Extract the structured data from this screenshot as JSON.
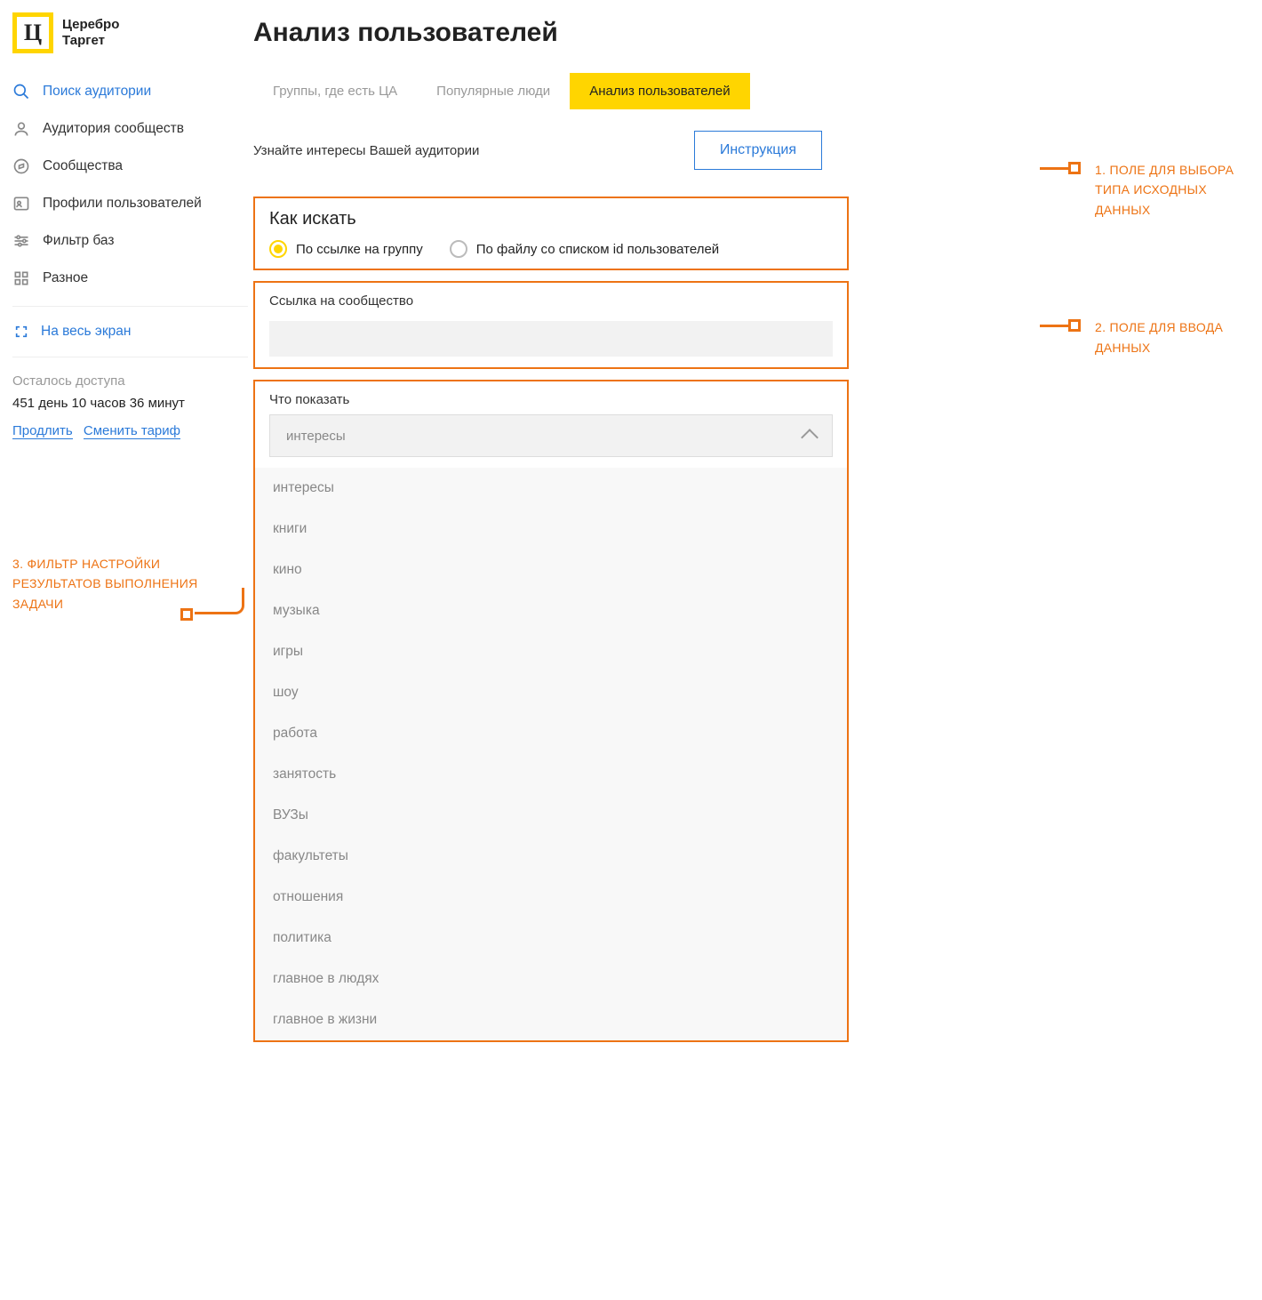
{
  "brand": {
    "line1": "Церебро",
    "line2": "Таргет",
    "letter": "Ц"
  },
  "sidebar": {
    "items": [
      {
        "label": "Поиск аудитории"
      },
      {
        "label": "Аудитория сообществ"
      },
      {
        "label": "Сообщества"
      },
      {
        "label": "Профили пользователей"
      },
      {
        "label": "Фильтр баз"
      },
      {
        "label": "Разное"
      }
    ],
    "fullscreen": "На весь экран",
    "access_label": "Осталось доступа",
    "access_time": "451 день 10 часов 36 минут",
    "extend": "Продлить",
    "change_tariff": "Сменить тариф"
  },
  "page": {
    "title": "Анализ пользователей",
    "tabs": [
      {
        "label": "Группы, где есть ЦА"
      },
      {
        "label": "Популярные люди"
      },
      {
        "label": "Анализ пользователей"
      }
    ],
    "subhead": "Узнайте интересы Вашей аудитории",
    "instruction_btn": "Инструкция"
  },
  "how": {
    "title": "Как искать",
    "opt1": "По ссылке на группу",
    "opt2": "По файлу со списком id пользователей"
  },
  "link_card": {
    "label": "Ссылка на сообщество"
  },
  "show_card": {
    "label": "Что показать",
    "selected": "интересы",
    "options": [
      "интересы",
      "книги",
      "кино",
      "музыка",
      "игры",
      "шоу",
      "работа",
      "занятость",
      "ВУЗы",
      "факультеты",
      "отношения",
      "политика",
      "главное в людях",
      "главное в жизни"
    ]
  },
  "annotations": {
    "a1": "1. Поле для выбора типа исходных данных",
    "a2": "2. Поле для ввода данных",
    "a3": "3. Фильтр настройки результатов выполнения задачи"
  }
}
